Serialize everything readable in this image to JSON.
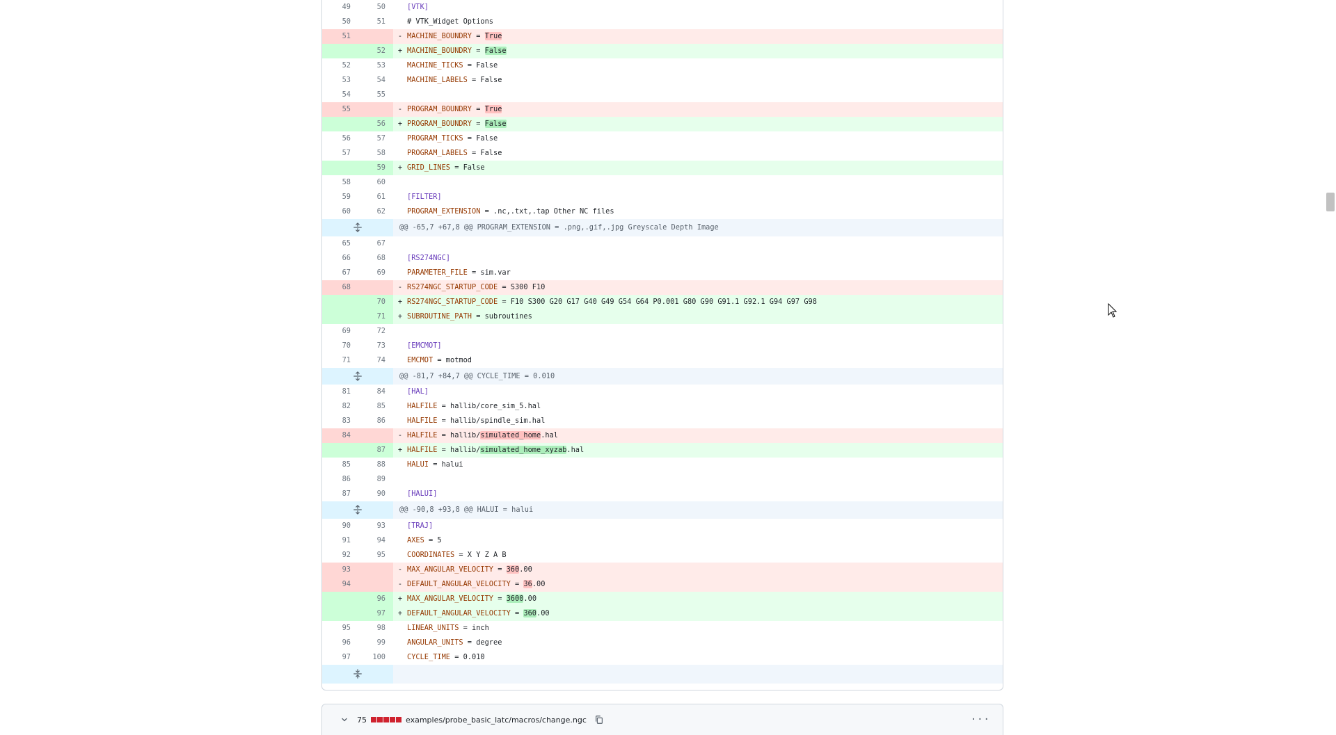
{
  "diff_lines": [
    {
      "type": "ctx",
      "old": "49",
      "new": "50",
      "sign": "",
      "parts": [
        {
          "t": "[VTK]",
          "c": "sec"
        }
      ]
    },
    {
      "type": "ctx",
      "old": "50",
      "new": "51",
      "sign": "",
      "parts": [
        {
          "t": "# VTK_Widget Options",
          "c": ""
        }
      ]
    },
    {
      "type": "del",
      "old": "51",
      "new": "",
      "sign": "-",
      "parts": [
        {
          "t": "MACHINE_BOUNDRY",
          "c": "k"
        },
        {
          "t": " = ",
          "c": ""
        },
        {
          "t": "True",
          "c": "hl-del"
        }
      ]
    },
    {
      "type": "add",
      "old": "",
      "new": "52",
      "sign": "+",
      "parts": [
        {
          "t": "MACHINE_BOUNDRY",
          "c": "k"
        },
        {
          "t": " = ",
          "c": ""
        },
        {
          "t": "False",
          "c": "hl-add"
        }
      ]
    },
    {
      "type": "ctx",
      "old": "52",
      "new": "53",
      "sign": "",
      "parts": [
        {
          "t": "MACHINE_TICKS",
          "c": "k"
        },
        {
          "t": " = False",
          "c": ""
        }
      ]
    },
    {
      "type": "ctx",
      "old": "53",
      "new": "54",
      "sign": "",
      "parts": [
        {
          "t": "MACHINE_LABELS",
          "c": "k"
        },
        {
          "t": " = False",
          "c": ""
        }
      ]
    },
    {
      "type": "ctx",
      "old": "54",
      "new": "55",
      "sign": "",
      "parts": []
    },
    {
      "type": "del",
      "old": "55",
      "new": "",
      "sign": "-",
      "parts": [
        {
          "t": "PROGRAM_BOUNDRY",
          "c": "k"
        },
        {
          "t": " = ",
          "c": ""
        },
        {
          "t": "True",
          "c": "hl-del"
        }
      ]
    },
    {
      "type": "add",
      "old": "",
      "new": "56",
      "sign": "+",
      "parts": [
        {
          "t": "PROGRAM_BOUNDRY",
          "c": "k"
        },
        {
          "t": " = ",
          "c": ""
        },
        {
          "t": "False",
          "c": "hl-add"
        }
      ]
    },
    {
      "type": "ctx",
      "old": "56",
      "new": "57",
      "sign": "",
      "parts": [
        {
          "t": "PROGRAM_TICKS",
          "c": "k"
        },
        {
          "t": " = False",
          "c": ""
        }
      ]
    },
    {
      "type": "ctx",
      "old": "57",
      "new": "58",
      "sign": "",
      "parts": [
        {
          "t": "PROGRAM_LABELS",
          "c": "k"
        },
        {
          "t": " = False",
          "c": ""
        }
      ]
    },
    {
      "type": "add",
      "old": "",
      "new": "59",
      "sign": "+",
      "parts": [
        {
          "t": "GRID_LINES",
          "c": "k"
        },
        {
          "t": " = False",
          "c": ""
        }
      ]
    },
    {
      "type": "ctx",
      "old": "58",
      "new": "60",
      "sign": "",
      "parts": []
    },
    {
      "type": "ctx",
      "old": "59",
      "new": "61",
      "sign": "",
      "parts": [
        {
          "t": "[FILTER]",
          "c": "sec"
        }
      ]
    },
    {
      "type": "ctx",
      "old": "60",
      "new": "62",
      "sign": "",
      "parts": [
        {
          "t": "PROGRAM_EXTENSION",
          "c": "k"
        },
        {
          "t": " = .nc,.txt,.tap Other NC files",
          "c": ""
        }
      ]
    },
    {
      "type": "hunk",
      "text": "@@ -65,7 +67,8 @@ PROGRAM_EXTENSION = .png,.gif,.jpg Greyscale Depth Image"
    },
    {
      "type": "ctx",
      "old": "65",
      "new": "67",
      "sign": "",
      "parts": []
    },
    {
      "type": "ctx",
      "old": "66",
      "new": "68",
      "sign": "",
      "parts": [
        {
          "t": "[RS274NGC]",
          "c": "sec"
        }
      ]
    },
    {
      "type": "ctx",
      "old": "67",
      "new": "69",
      "sign": "",
      "parts": [
        {
          "t": "PARAMETER_FILE",
          "c": "k"
        },
        {
          "t": " = sim.var",
          "c": ""
        }
      ]
    },
    {
      "type": "del",
      "old": "68",
      "new": "",
      "sign": "-",
      "parts": [
        {
          "t": "RS274NGC_STARTUP_CODE",
          "c": "k"
        },
        {
          "t": " = S300 F10",
          "c": ""
        }
      ]
    },
    {
      "type": "add",
      "old": "",
      "new": "70",
      "sign": "+",
      "parts": [
        {
          "t": "RS274NGC_STARTUP_CODE",
          "c": "k"
        },
        {
          "t": " = F10 S300 G20 G17 G40 G49 G54 G64 P0.001 G80 G90 G91.1 G92.1 G94 G97 G98",
          "c": ""
        }
      ]
    },
    {
      "type": "add",
      "old": "",
      "new": "71",
      "sign": "+",
      "parts": [
        {
          "t": "SUBROUTINE_PATH",
          "c": "k"
        },
        {
          "t": " = subroutines",
          "c": ""
        }
      ]
    },
    {
      "type": "ctx",
      "old": "69",
      "new": "72",
      "sign": "",
      "parts": []
    },
    {
      "type": "ctx",
      "old": "70",
      "new": "73",
      "sign": "",
      "parts": [
        {
          "t": "[EMCMOT]",
          "c": "sec"
        }
      ]
    },
    {
      "type": "ctx",
      "old": "71",
      "new": "74",
      "sign": "",
      "parts": [
        {
          "t": "EMCMOT",
          "c": "k"
        },
        {
          "t": " = motmod",
          "c": ""
        }
      ]
    },
    {
      "type": "hunk",
      "text": "@@ -81,7 +84,7 @@ CYCLE_TIME = 0.010"
    },
    {
      "type": "ctx",
      "old": "81",
      "new": "84",
      "sign": "",
      "parts": [
        {
          "t": "[HAL]",
          "c": "sec"
        }
      ]
    },
    {
      "type": "ctx",
      "old": "82",
      "new": "85",
      "sign": "",
      "parts": [
        {
          "t": "HALFILE",
          "c": "k"
        },
        {
          "t": " = hallib/core_sim_5.hal",
          "c": ""
        }
      ]
    },
    {
      "type": "ctx",
      "old": "83",
      "new": "86",
      "sign": "",
      "parts": [
        {
          "t": "HALFILE",
          "c": "k"
        },
        {
          "t": " = hallib/spindle_sim.hal",
          "c": ""
        }
      ]
    },
    {
      "type": "del",
      "old": "84",
      "new": "",
      "sign": "-",
      "parts": [
        {
          "t": "HALFILE",
          "c": "k"
        },
        {
          "t": " = hallib/",
          "c": ""
        },
        {
          "t": "simulated_home",
          "c": "hl-del"
        },
        {
          "t": ".hal",
          "c": ""
        }
      ]
    },
    {
      "type": "add",
      "old": "",
      "new": "87",
      "sign": "+",
      "parts": [
        {
          "t": "HALFILE",
          "c": "k"
        },
        {
          "t": " = hallib/",
          "c": ""
        },
        {
          "t": "simulated_home_xyzab",
          "c": "hl-add"
        },
        {
          "t": ".hal",
          "c": ""
        }
      ]
    },
    {
      "type": "ctx",
      "old": "85",
      "new": "88",
      "sign": "",
      "parts": [
        {
          "t": "HALUI",
          "c": "k"
        },
        {
          "t": " = halui",
          "c": ""
        }
      ]
    },
    {
      "type": "ctx",
      "old": "86",
      "new": "89",
      "sign": "",
      "parts": []
    },
    {
      "type": "ctx",
      "old": "87",
      "new": "90",
      "sign": "",
      "parts": [
        {
          "t": "[HALUI]",
          "c": "sec"
        }
      ]
    },
    {
      "type": "hunk",
      "text": "@@ -90,8 +93,8 @@ HALUI = halui"
    },
    {
      "type": "ctx",
      "old": "90",
      "new": "93",
      "sign": "",
      "parts": [
        {
          "t": "[TRAJ]",
          "c": "sec"
        }
      ]
    },
    {
      "type": "ctx",
      "old": "91",
      "new": "94",
      "sign": "",
      "parts": [
        {
          "t": "AXES",
          "c": "k"
        },
        {
          "t": " = 5",
          "c": ""
        }
      ]
    },
    {
      "type": "ctx",
      "old": "92",
      "new": "95",
      "sign": "",
      "parts": [
        {
          "t": "COORDINATES",
          "c": "k"
        },
        {
          "t": " = X Y Z A B",
          "c": ""
        }
      ]
    },
    {
      "type": "del",
      "old": "93",
      "new": "",
      "sign": "-",
      "parts": [
        {
          "t": "MAX_ANGULAR_VELOCITY",
          "c": "k"
        },
        {
          "t": " = ",
          "c": ""
        },
        {
          "t": "360",
          "c": "hl-del"
        },
        {
          "t": ".00",
          "c": ""
        }
      ]
    },
    {
      "type": "del",
      "old": "94",
      "new": "",
      "sign": "-",
      "parts": [
        {
          "t": "DEFAULT_ANGULAR_VELOCITY",
          "c": "k"
        },
        {
          "t": " = ",
          "c": ""
        },
        {
          "t": "36",
          "c": "hl-del"
        },
        {
          "t": ".00",
          "c": ""
        }
      ]
    },
    {
      "type": "add",
      "old": "",
      "new": "96",
      "sign": "+",
      "parts": [
        {
          "t": "MAX_ANGULAR_VELOCITY",
          "c": "k"
        },
        {
          "t": " = ",
          "c": ""
        },
        {
          "t": "3600",
          "c": "hl-add"
        },
        {
          "t": ".00",
          "c": ""
        }
      ]
    },
    {
      "type": "add",
      "old": "",
      "new": "97",
      "sign": "+",
      "parts": [
        {
          "t": "DEFAULT_ANGULAR_VELOCITY",
          "c": "k"
        },
        {
          "t": " = ",
          "c": ""
        },
        {
          "t": "360",
          "c": "hl-add"
        },
        {
          "t": ".00",
          "c": ""
        }
      ]
    },
    {
      "type": "ctx",
      "old": "95",
      "new": "98",
      "sign": "",
      "parts": [
        {
          "t": "LINEAR_UNITS",
          "c": "k"
        },
        {
          "t": " = inch",
          "c": ""
        }
      ]
    },
    {
      "type": "ctx",
      "old": "96",
      "new": "99",
      "sign": "",
      "parts": [
        {
          "t": "ANGULAR_UNITS",
          "c": "k"
        },
        {
          "t": " = degree",
          "c": ""
        }
      ]
    },
    {
      "type": "ctx",
      "old": "97",
      "new": "100",
      "sign": "",
      "parts": [
        {
          "t": "CYCLE_TIME",
          "c": "k"
        },
        {
          "t": " = 0.010",
          "c": ""
        }
      ]
    }
  ],
  "next_file": {
    "change_count": "75",
    "path": "examples/probe_basic_latc/macros/change.ngc",
    "more_label": "···",
    "deleted_blocks": 5
  },
  "icons": {
    "expand": "unfold-icon",
    "chevron": "chevron-down-icon",
    "copy": "copy-icon",
    "more": "kebab-horizontal-icon"
  },
  "colors": {
    "deletion_bg": "#ffebe9",
    "addition_bg": "#e6ffec",
    "hunk_bg": "#f0f6fc",
    "key_color": "#953800",
    "section_color": "#6639ba",
    "diffstat_red": "#cf222e"
  }
}
